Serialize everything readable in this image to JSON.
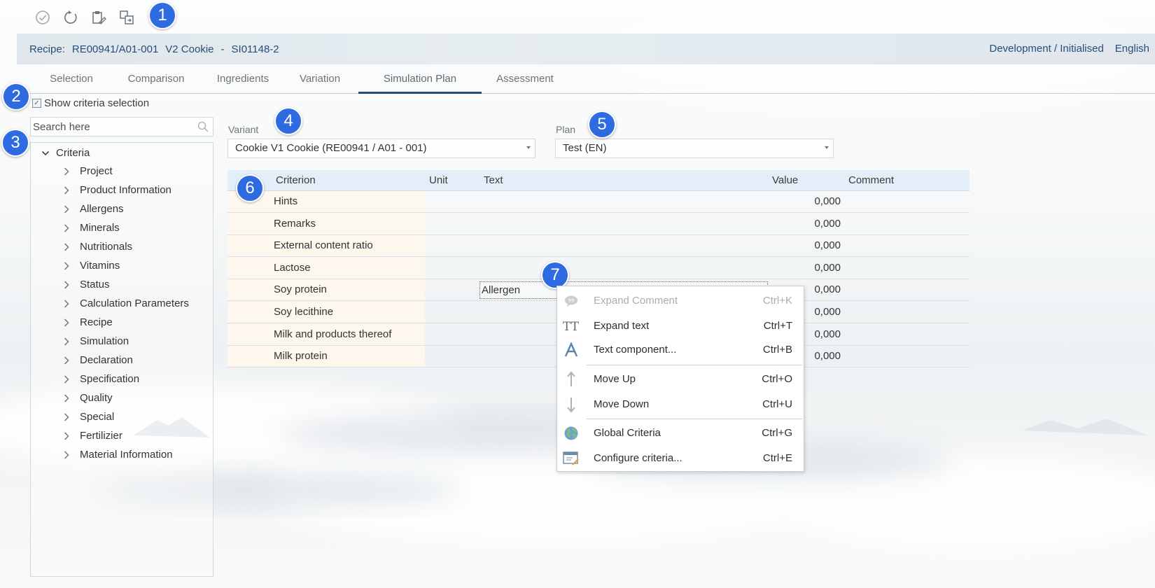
{
  "toolbar": {
    "icons": [
      "check-circle-icon",
      "refresh-icon",
      "clipboard-edit-icon",
      "copy-swap-icon"
    ]
  },
  "header": {
    "recipe_label": "Recipe:",
    "recipe_code": "RE00941/A01-001",
    "recipe_name": "V2 Cookie",
    "separator": "-",
    "recipe_si": "SI01148-2",
    "status": "Development / Initialised",
    "language": "English"
  },
  "tabs": [
    {
      "label": "Selection"
    },
    {
      "label": "Comparison"
    },
    {
      "label": "Ingredients"
    },
    {
      "label": "Variation"
    },
    {
      "label": "Simulation Plan",
      "active": true
    },
    {
      "label": "Assessment"
    }
  ],
  "criteria_toggle": {
    "label": "Show criteria selection",
    "checked": true
  },
  "search": {
    "placeholder": "Search here"
  },
  "tree": {
    "root": "Criteria",
    "items": [
      "Project",
      "Product Information",
      "Allergens",
      "Minerals",
      "Nutritionals",
      "Vitamins",
      "Status",
      "Calculation Parameters",
      "Recipe",
      "Simulation",
      "Declaration",
      "Specification",
      "Quality",
      "Special",
      "Fertilizier",
      "Material Information"
    ]
  },
  "variant": {
    "label": "Variant",
    "value": "Cookie V1 Cookie  (RE00941 / A01 - 001)"
  },
  "plan": {
    "label": "Plan",
    "value": "Test (EN)"
  },
  "table": {
    "headers": {
      "criterion": "Criterion",
      "unit": "Unit",
      "text": "Text",
      "value": "Value",
      "comment": "Comment"
    },
    "rows": [
      {
        "criterion": "Hints",
        "text": "",
        "value": "0,000"
      },
      {
        "criterion": "Remarks",
        "text": "",
        "value": "0,000"
      },
      {
        "criterion": "External content ratio",
        "text": "",
        "value": "0,000"
      },
      {
        "criterion": "Lactose",
        "text": "",
        "value": "0,000"
      },
      {
        "criterion": "Soy protein",
        "text": "Allergen",
        "value": "0,000"
      },
      {
        "criterion": "Soy lecithine",
        "text": "",
        "value": "0,000"
      },
      {
        "criterion": "Milk and products thereof",
        "text": "",
        "value": "0,000"
      },
      {
        "criterion": "Milk protein",
        "text": "",
        "value": "0,000"
      }
    ]
  },
  "context_menu": {
    "items": [
      {
        "label": "Expand Comment",
        "shortcut": "Ctrl+K",
        "icon": "comment-icon",
        "disabled": true
      },
      {
        "label": "Expand text",
        "shortcut": "Ctrl+T",
        "icon": "text-size-icon"
      },
      {
        "label": "Text component...",
        "shortcut": "Ctrl+B",
        "icon": "font-a-icon"
      },
      {
        "label": "Move Up",
        "shortcut": "Ctrl+O",
        "icon": "arrow-up-icon"
      },
      {
        "label": "Move Down",
        "shortcut": "Ctrl+U",
        "icon": "arrow-down-icon"
      },
      {
        "label": "Global Criteria",
        "shortcut": "Ctrl+G",
        "icon": "globe-icon"
      },
      {
        "label": "Configure criteria...",
        "shortcut": "Ctrl+E",
        "icon": "configure-window-icon"
      }
    ]
  },
  "callouts": [
    "1",
    "2",
    "3",
    "4",
    "5",
    "6",
    "7"
  ],
  "colors": {
    "accent": "#2b4c73",
    "callout": "#2f6be0",
    "header_text": "#274d78"
  }
}
